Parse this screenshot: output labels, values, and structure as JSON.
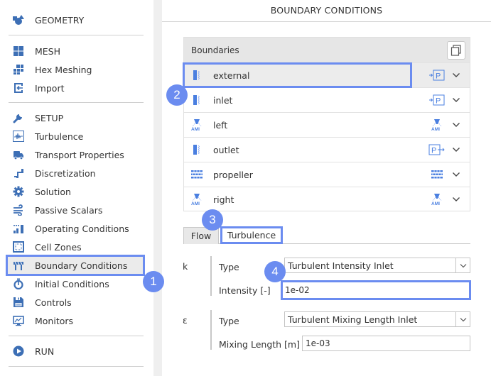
{
  "sidebar": {
    "sections": [
      {
        "items": [
          {
            "label": "GEOMETRY",
            "icon": "geometry-icon"
          }
        ]
      },
      {
        "items": [
          {
            "label": "MESH",
            "icon": "mesh-icon"
          },
          {
            "label": "Hex Meshing",
            "icon": "hex-meshing-icon"
          },
          {
            "label": "Import",
            "icon": "import-icon"
          }
        ]
      },
      {
        "items": [
          {
            "label": "SETUP",
            "icon": "wrench-icon"
          },
          {
            "label": "Turbulence",
            "icon": "turbulence-icon"
          },
          {
            "label": "Transport Properties",
            "icon": "truck-icon"
          },
          {
            "label": "Discretization",
            "icon": "discretization-icon"
          },
          {
            "label": "Solution",
            "icon": "gear-icon"
          },
          {
            "label": "Passive Scalars",
            "icon": "wind-icon"
          },
          {
            "label": "Operating Conditions",
            "icon": "bar-chart-icon"
          },
          {
            "label": "Cell Zones",
            "icon": "cell-zones-icon"
          },
          {
            "label": "Boundary Conditions",
            "icon": "barrier-icon",
            "active": true
          },
          {
            "label": "Initial Conditions",
            "icon": "stopwatch-icon"
          },
          {
            "label": "Controls",
            "icon": "save-icon"
          },
          {
            "label": "Monitors",
            "icon": "monitor-icon"
          }
        ]
      },
      {
        "items": [
          {
            "label": "RUN",
            "icon": "play-icon"
          }
        ]
      }
    ]
  },
  "main": {
    "title": "BOUNDARY CONDITIONS",
    "boundaries": {
      "header": "Boundaries",
      "copy_icon": "copy-icon",
      "rows": [
        {
          "name": "external",
          "type_icon": "wall-icon",
          "bc_icon": "pressure-inlet-icon",
          "selected": true
        },
        {
          "name": "inlet",
          "type_icon": "wall-icon",
          "bc_icon": "pressure-inlet-icon"
        },
        {
          "name": "left",
          "type_icon": "ami-icon",
          "bc_icon": "ami-icon"
        },
        {
          "name": "outlet",
          "type_icon": "wall-icon",
          "bc_icon": "pressure-outlet-icon"
        },
        {
          "name": "propeller",
          "type_icon": "grid-wall-icon",
          "bc_icon": "grid-wall-icon"
        },
        {
          "name": "right",
          "type_icon": "ami-icon",
          "bc_icon": "ami-icon"
        }
      ]
    },
    "tabs": [
      {
        "label": "Flow",
        "active": false
      },
      {
        "label": "Turbulence",
        "active": true
      }
    ],
    "k_group": {
      "symbol": "k",
      "type_label": "Type",
      "type_value": "Turbulent Intensity Inlet",
      "value_label": "Intensity [-]",
      "value": "1e-02"
    },
    "eps_group": {
      "symbol": "ε",
      "type_label": "Type",
      "type_value": "Turbulent Mixing Length Inlet",
      "value_label": "Mixing Length [m]",
      "value": "1e-03"
    }
  },
  "annotations": [
    "1",
    "2",
    "3",
    "4"
  ],
  "colors": {
    "accent": "#6b8cf0",
    "icon_blue": "#3c78c8"
  }
}
